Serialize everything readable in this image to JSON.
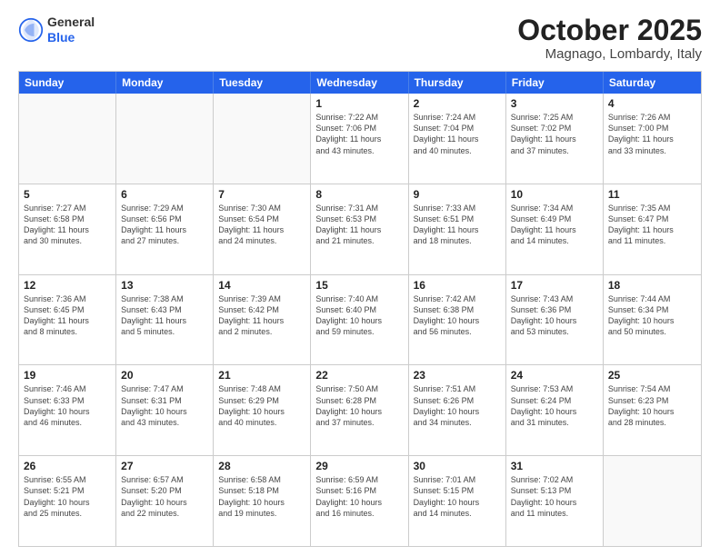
{
  "logo": {
    "general": "General",
    "blue": "Blue"
  },
  "header": {
    "month": "October 2025",
    "location": "Magnago, Lombardy, Italy"
  },
  "weekdays": [
    "Sunday",
    "Monday",
    "Tuesday",
    "Wednesday",
    "Thursday",
    "Friday",
    "Saturday"
  ],
  "rows": [
    [
      {
        "day": "",
        "lines": []
      },
      {
        "day": "",
        "lines": []
      },
      {
        "day": "",
        "lines": []
      },
      {
        "day": "1",
        "lines": [
          "Sunrise: 7:22 AM",
          "Sunset: 7:06 PM",
          "Daylight: 11 hours",
          "and 43 minutes."
        ]
      },
      {
        "day": "2",
        "lines": [
          "Sunrise: 7:24 AM",
          "Sunset: 7:04 PM",
          "Daylight: 11 hours",
          "and 40 minutes."
        ]
      },
      {
        "day": "3",
        "lines": [
          "Sunrise: 7:25 AM",
          "Sunset: 7:02 PM",
          "Daylight: 11 hours",
          "and 37 minutes."
        ]
      },
      {
        "day": "4",
        "lines": [
          "Sunrise: 7:26 AM",
          "Sunset: 7:00 PM",
          "Daylight: 11 hours",
          "and 33 minutes."
        ]
      }
    ],
    [
      {
        "day": "5",
        "lines": [
          "Sunrise: 7:27 AM",
          "Sunset: 6:58 PM",
          "Daylight: 11 hours",
          "and 30 minutes."
        ]
      },
      {
        "day": "6",
        "lines": [
          "Sunrise: 7:29 AM",
          "Sunset: 6:56 PM",
          "Daylight: 11 hours",
          "and 27 minutes."
        ]
      },
      {
        "day": "7",
        "lines": [
          "Sunrise: 7:30 AM",
          "Sunset: 6:54 PM",
          "Daylight: 11 hours",
          "and 24 minutes."
        ]
      },
      {
        "day": "8",
        "lines": [
          "Sunrise: 7:31 AM",
          "Sunset: 6:53 PM",
          "Daylight: 11 hours",
          "and 21 minutes."
        ]
      },
      {
        "day": "9",
        "lines": [
          "Sunrise: 7:33 AM",
          "Sunset: 6:51 PM",
          "Daylight: 11 hours",
          "and 18 minutes."
        ]
      },
      {
        "day": "10",
        "lines": [
          "Sunrise: 7:34 AM",
          "Sunset: 6:49 PM",
          "Daylight: 11 hours",
          "and 14 minutes."
        ]
      },
      {
        "day": "11",
        "lines": [
          "Sunrise: 7:35 AM",
          "Sunset: 6:47 PM",
          "Daylight: 11 hours",
          "and 11 minutes."
        ]
      }
    ],
    [
      {
        "day": "12",
        "lines": [
          "Sunrise: 7:36 AM",
          "Sunset: 6:45 PM",
          "Daylight: 11 hours",
          "and 8 minutes."
        ]
      },
      {
        "day": "13",
        "lines": [
          "Sunrise: 7:38 AM",
          "Sunset: 6:43 PM",
          "Daylight: 11 hours",
          "and 5 minutes."
        ]
      },
      {
        "day": "14",
        "lines": [
          "Sunrise: 7:39 AM",
          "Sunset: 6:42 PM",
          "Daylight: 11 hours",
          "and 2 minutes."
        ]
      },
      {
        "day": "15",
        "lines": [
          "Sunrise: 7:40 AM",
          "Sunset: 6:40 PM",
          "Daylight: 10 hours",
          "and 59 minutes."
        ]
      },
      {
        "day": "16",
        "lines": [
          "Sunrise: 7:42 AM",
          "Sunset: 6:38 PM",
          "Daylight: 10 hours",
          "and 56 minutes."
        ]
      },
      {
        "day": "17",
        "lines": [
          "Sunrise: 7:43 AM",
          "Sunset: 6:36 PM",
          "Daylight: 10 hours",
          "and 53 minutes."
        ]
      },
      {
        "day": "18",
        "lines": [
          "Sunrise: 7:44 AM",
          "Sunset: 6:34 PM",
          "Daylight: 10 hours",
          "and 50 minutes."
        ]
      }
    ],
    [
      {
        "day": "19",
        "lines": [
          "Sunrise: 7:46 AM",
          "Sunset: 6:33 PM",
          "Daylight: 10 hours",
          "and 46 minutes."
        ]
      },
      {
        "day": "20",
        "lines": [
          "Sunrise: 7:47 AM",
          "Sunset: 6:31 PM",
          "Daylight: 10 hours",
          "and 43 minutes."
        ]
      },
      {
        "day": "21",
        "lines": [
          "Sunrise: 7:48 AM",
          "Sunset: 6:29 PM",
          "Daylight: 10 hours",
          "and 40 minutes."
        ]
      },
      {
        "day": "22",
        "lines": [
          "Sunrise: 7:50 AM",
          "Sunset: 6:28 PM",
          "Daylight: 10 hours",
          "and 37 minutes."
        ]
      },
      {
        "day": "23",
        "lines": [
          "Sunrise: 7:51 AM",
          "Sunset: 6:26 PM",
          "Daylight: 10 hours",
          "and 34 minutes."
        ]
      },
      {
        "day": "24",
        "lines": [
          "Sunrise: 7:53 AM",
          "Sunset: 6:24 PM",
          "Daylight: 10 hours",
          "and 31 minutes."
        ]
      },
      {
        "day": "25",
        "lines": [
          "Sunrise: 7:54 AM",
          "Sunset: 6:23 PM",
          "Daylight: 10 hours",
          "and 28 minutes."
        ]
      }
    ],
    [
      {
        "day": "26",
        "lines": [
          "Sunrise: 6:55 AM",
          "Sunset: 5:21 PM",
          "Daylight: 10 hours",
          "and 25 minutes."
        ]
      },
      {
        "day": "27",
        "lines": [
          "Sunrise: 6:57 AM",
          "Sunset: 5:20 PM",
          "Daylight: 10 hours",
          "and 22 minutes."
        ]
      },
      {
        "day": "28",
        "lines": [
          "Sunrise: 6:58 AM",
          "Sunset: 5:18 PM",
          "Daylight: 10 hours",
          "and 19 minutes."
        ]
      },
      {
        "day": "29",
        "lines": [
          "Sunrise: 6:59 AM",
          "Sunset: 5:16 PM",
          "Daylight: 10 hours",
          "and 16 minutes."
        ]
      },
      {
        "day": "30",
        "lines": [
          "Sunrise: 7:01 AM",
          "Sunset: 5:15 PM",
          "Daylight: 10 hours",
          "and 14 minutes."
        ]
      },
      {
        "day": "31",
        "lines": [
          "Sunrise: 7:02 AM",
          "Sunset: 5:13 PM",
          "Daylight: 10 hours",
          "and 11 minutes."
        ]
      },
      {
        "day": "",
        "lines": []
      }
    ]
  ]
}
